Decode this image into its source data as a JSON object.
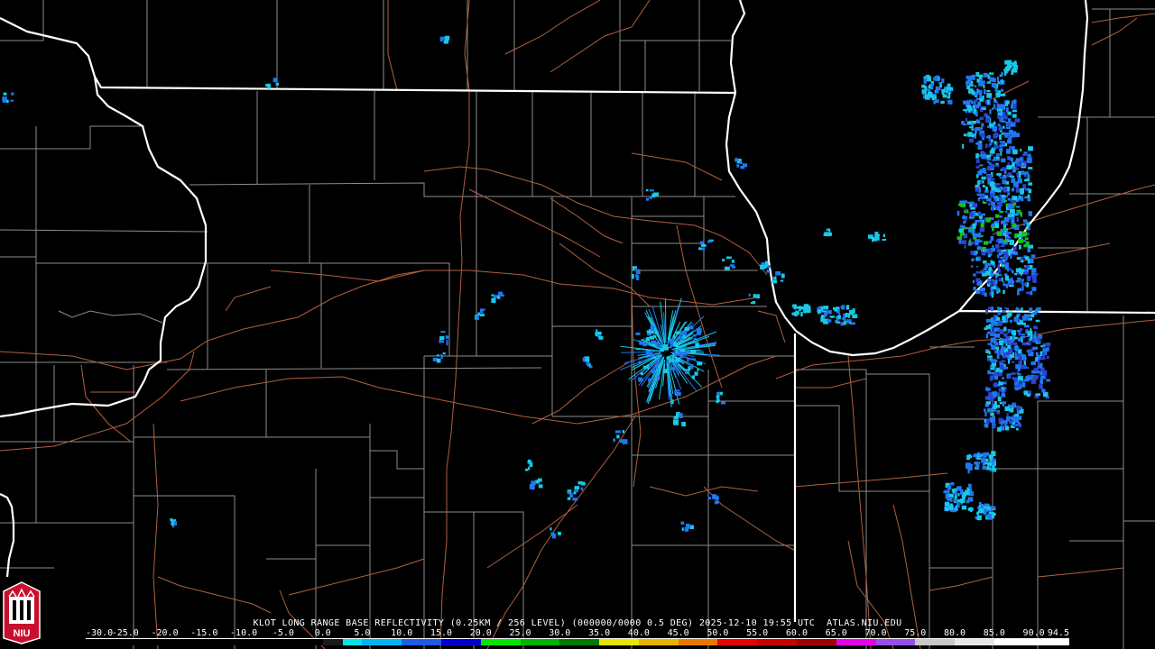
{
  "product_caption": "KLOT LONG RANGE BASE REFLECTIVITY (0.25KM / 256 LEVEL) (000000/0000 0.5 DEG) 2025-12-10 19:55 UTC  ATLAS.NIU.EDU",
  "scale": {
    "labels": [
      "-30.0",
      "-25.0",
      "-20.0",
      "-15.0",
      "-10.0",
      "-5.0",
      "0.0",
      "5.0",
      "10.0",
      "15.0",
      "20.0",
      "25.0",
      "30.0",
      "35.0",
      "40.0",
      "45.0",
      "50.0",
      "55.0",
      "60.0",
      "65.0",
      "70.0",
      "75.0",
      "80.0",
      "85.0",
      "90.0",
      "94.5"
    ],
    "min": -30.0,
    "max": 94.5,
    "segments": [
      {
        "from": -30,
        "to": -20,
        "color": "#000000"
      },
      {
        "from": -20,
        "to": -10,
        "color": "#000000"
      },
      {
        "from": -10,
        "to": 0,
        "color": "#000000"
      },
      {
        "from": 0,
        "to": 2.5,
        "color": "#1a1a1a"
      },
      {
        "from": 2.5,
        "to": 5,
        "color": "#00e5e5"
      },
      {
        "from": 5,
        "to": 10,
        "color": "#00b4f0"
      },
      {
        "from": 10,
        "to": 15,
        "color": "#1e5ae6"
      },
      {
        "from": 15,
        "to": 20,
        "color": "#0000cc"
      },
      {
        "from": 20,
        "to": 25,
        "color": "#00e600"
      },
      {
        "from": 25,
        "to": 30,
        "color": "#00b400"
      },
      {
        "from": 30,
        "to": 35,
        "color": "#007800"
      },
      {
        "from": 35,
        "to": 40,
        "color": "#e6e600"
      },
      {
        "from": 40,
        "to": 45,
        "color": "#e6b400"
      },
      {
        "from": 45,
        "to": 50,
        "color": "#e67800"
      },
      {
        "from": 50,
        "to": 55,
        "color": "#e60000"
      },
      {
        "from": 55,
        "to": 60,
        "color": "#c80000"
      },
      {
        "from": 60,
        "to": 65,
        "color": "#a00000"
      },
      {
        "from": 65,
        "to": 70,
        "color": "#e600e6"
      },
      {
        "from": 70,
        "to": 75,
        "color": "#9650e6"
      },
      {
        "from": 75,
        "to": 80,
        "color": "#c8c8c8"
      },
      {
        "from": 80,
        "to": 85,
        "color": "#e6e6e6"
      },
      {
        "from": 85,
        "to": 94.5,
        "color": "#ffffff"
      }
    ]
  },
  "colors": {
    "background": "#000000",
    "state_border": "#ffffff",
    "county_line": "#8c8c8c",
    "road": "#b0613f",
    "echo_light": "#19c8e6",
    "echo_medium": "#1e78f0",
    "echo_strong": "#2846d2",
    "echo_green": "#16c416",
    "logo_red": "#c8102e"
  },
  "logo": {
    "icon": "niu-huskie-tower-logo",
    "text": "NIU"
  }
}
